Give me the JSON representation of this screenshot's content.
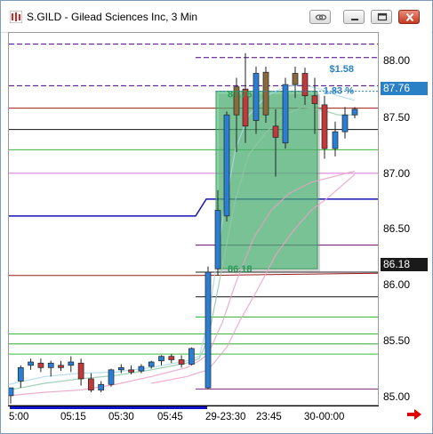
{
  "window": {
    "title": "S.GILD - Gilead Sciences Inc, 3 Min",
    "buttons": [
      "link-icon",
      "minimize-icon",
      "maximize-icon",
      "close-icon"
    ]
  },
  "price_axis": {
    "ticks": [
      "88.00",
      "87.50",
      "87.00",
      "86.50",
      "86.00",
      "85.50",
      "85.00"
    ],
    "current_price_label": "87.76",
    "entry_price_label": "86.18"
  },
  "time_axis": {
    "ticks": [
      "5:00",
      "05:15",
      "05:30",
      "05:45",
      "29-23:30",
      "23:45",
      "30-00:00"
    ]
  },
  "trade_box": {
    "profit_label": "$1.58",
    "percent_label": "1.83 %",
    "top_label": "87.76",
    "entry_label": "86.18"
  },
  "colors": {
    "up_candle": "#2a7fd4",
    "down_candle": "#c0393b",
    "neutral_candle": "#8a6a3c",
    "trade_fill": "#3cb56a",
    "current_price_bg": "#2a80c5",
    "entry_price_bg": "#1a1a1a"
  },
  "chart_data": {
    "type": "candlestick",
    "title": "S.GILD - Gilead Sciences Inc, 3 Min",
    "ylim": [
      84.97,
      88.28
    ],
    "x_labels": [
      "5:00",
      "05:15",
      "05:30",
      "05:45",
      "29-23:30",
      "23:45",
      "30-00:00"
    ],
    "candles": [
      {
        "o": 85.05,
        "h": 85.12,
        "l": 84.98,
        "c": 85.12
      },
      {
        "o": 85.18,
        "h": 85.32,
        "l": 85.12,
        "c": 85.3
      },
      {
        "o": 85.32,
        "h": 85.38,
        "l": 85.28,
        "c": 85.35
      },
      {
        "o": 85.34,
        "h": 85.38,
        "l": 85.26,
        "c": 85.3
      },
      {
        "o": 85.3,
        "h": 85.36,
        "l": 85.22,
        "c": 85.34
      },
      {
        "o": 85.32,
        "h": 85.36,
        "l": 85.27,
        "c": 85.3
      },
      {
        "o": 85.32,
        "h": 85.4,
        "l": 85.26,
        "c": 85.35
      },
      {
        "o": 85.34,
        "h": 85.38,
        "l": 85.14,
        "c": 85.2
      },
      {
        "o": 85.2,
        "h": 85.25,
        "l": 85.08,
        "c": 85.1
      },
      {
        "o": 85.1,
        "h": 85.18,
        "l": 85.08,
        "c": 85.15
      },
      {
        "o": 85.15,
        "h": 85.29,
        "l": 85.13,
        "c": 85.28
      },
      {
        "o": 85.28,
        "h": 85.33,
        "l": 85.25,
        "c": 85.3
      },
      {
        "o": 85.28,
        "h": 85.32,
        "l": 85.24,
        "c": 85.26
      },
      {
        "o": 85.27,
        "h": 85.33,
        "l": 85.25,
        "c": 85.31
      },
      {
        "o": 85.31,
        "h": 85.36,
        "l": 85.29,
        "c": 85.35
      },
      {
        "o": 85.36,
        "h": 85.41,
        "l": 85.32,
        "c": 85.4
      },
      {
        "o": 85.4,
        "h": 85.42,
        "l": 85.34,
        "c": 85.37
      },
      {
        "o": 85.37,
        "h": 85.41,
        "l": 85.3,
        "c": 85.33
      },
      {
        "o": 85.33,
        "h": 85.48,
        "l": 85.32,
        "c": 85.47
      },
      {
        "o": 85.12,
        "h": 86.2,
        "l": 85.11,
        "c": 86.15
      },
      {
        "o": 86.18,
        "h": 86.88,
        "l": 86.12,
        "c": 86.7
      },
      {
        "o": 86.65,
        "h": 87.58,
        "l": 86.6,
        "c": 87.55
      },
      {
        "o": 87.55,
        "h": 87.88,
        "l": 87.22,
        "c": 87.8
      },
      {
        "o": 87.78,
        "h": 88.1,
        "l": 87.3,
        "c": 87.45
      },
      {
        "o": 87.5,
        "h": 87.98,
        "l": 87.38,
        "c": 87.92
      },
      {
        "o": 87.93,
        "h": 87.98,
        "l": 87.48,
        "c": 87.55
      },
      {
        "o": 87.45,
        "h": 87.6,
        "l": 87.0,
        "c": 87.35
      },
      {
        "o": 87.3,
        "h": 87.88,
        "l": 87.25,
        "c": 87.82
      },
      {
        "o": 87.82,
        "h": 87.98,
        "l": 87.7,
        "c": 87.92
      },
      {
        "o": 87.92,
        "h": 87.97,
        "l": 87.64,
        "c": 87.72
      },
      {
        "o": 87.72,
        "h": 87.88,
        "l": 87.38,
        "c": 87.65
      },
      {
        "o": 87.64,
        "h": 87.72,
        "l": 87.16,
        "c": 87.25
      },
      {
        "o": 87.25,
        "h": 87.49,
        "l": 87.18,
        "c": 87.4
      },
      {
        "o": 87.4,
        "h": 87.62,
        "l": 87.34,
        "c": 87.55
      },
      {
        "o": 87.55,
        "h": 87.62,
        "l": 87.52,
        "c": 87.6
      }
    ],
    "horizontal_levels": [
      {
        "price": 88.18,
        "color": "#4b0082",
        "style": "dash",
        "from": "left"
      },
      {
        "price": 88.06,
        "color": "#4b0082",
        "style": "dash",
        "from": "right"
      },
      {
        "price": 87.81,
        "color": "#4b0082",
        "style": "dash",
        "from": "left"
      },
      {
        "price": 87.61,
        "color": "#a01818",
        "style": "solid",
        "from": "left"
      },
      {
        "price": 87.42,
        "color": "#111111",
        "style": "solid",
        "from": "left"
      },
      {
        "price": 87.24,
        "color": "#3db83d",
        "style": "solid",
        "from": "left"
      },
      {
        "price": 87.03,
        "color": "#d873d8",
        "style": "solid",
        "from": "left"
      },
      {
        "price": 86.39,
        "color": "#6a0a6a",
        "style": "solid",
        "from": "right"
      },
      {
        "price": 86.15,
        "color": "#222222",
        "style": "solid",
        "from": "right"
      },
      {
        "price": 85.93,
        "color": "#111111",
        "style": "solid",
        "from": "right"
      },
      {
        "price": 85.75,
        "color": "#3db83d",
        "style": "solid",
        "from": "right"
      },
      {
        "price": 85.6,
        "color": "#3db83d",
        "style": "solid",
        "from": "left"
      },
      {
        "price": 85.51,
        "color": "#2ea82e",
        "style": "solid",
        "from": "left"
      },
      {
        "price": 85.42,
        "color": "#3db83d",
        "style": "solid",
        "from": "left"
      },
      {
        "price": 85.11,
        "color": "#7a2b7a",
        "style": "solid",
        "from": "right"
      }
    ]
  }
}
